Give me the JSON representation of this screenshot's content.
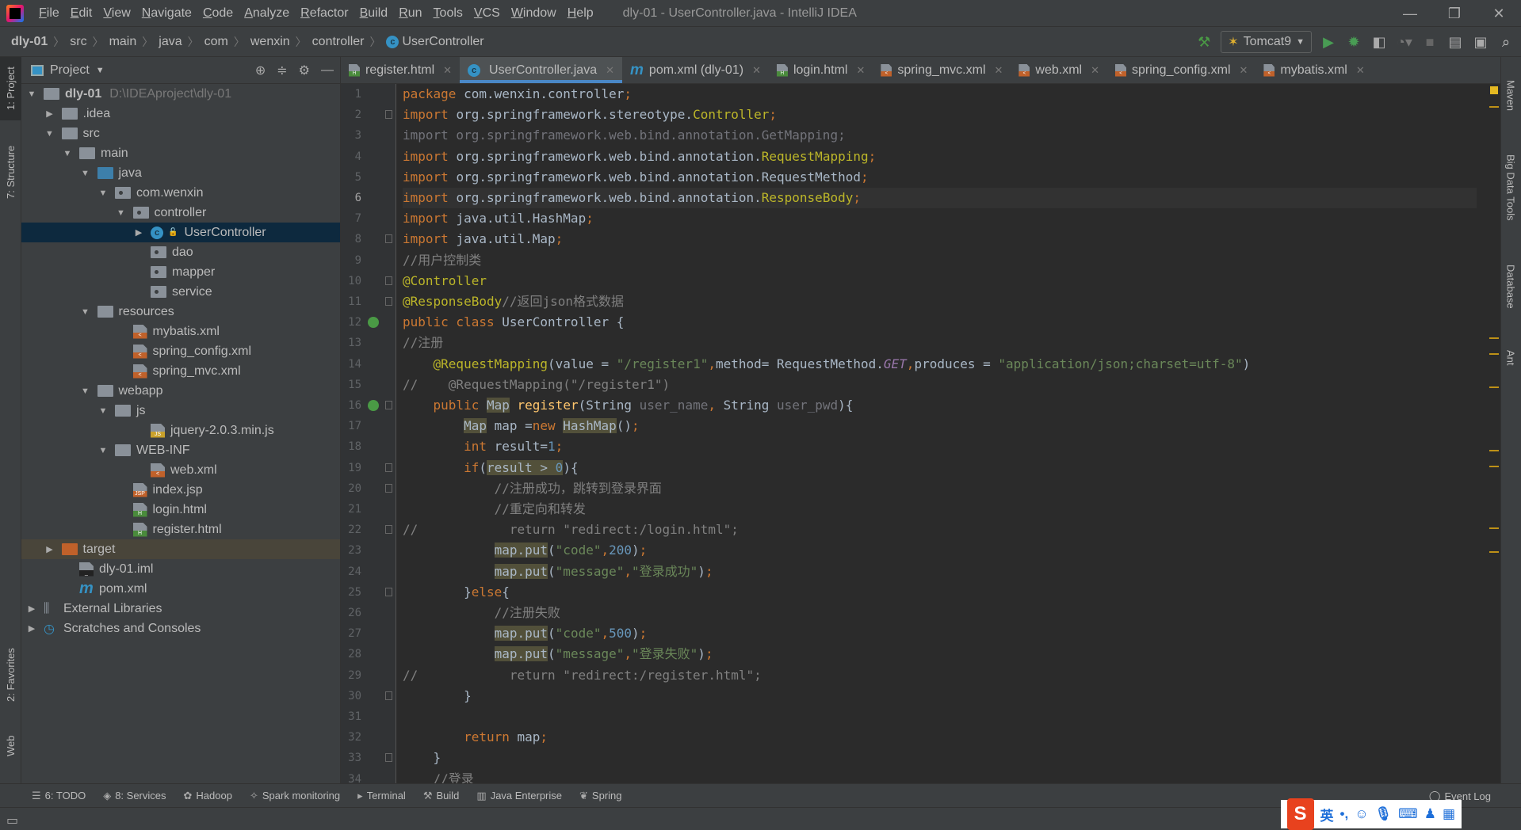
{
  "menubar": {
    "items": [
      "File",
      "Edit",
      "View",
      "Navigate",
      "Code",
      "Analyze",
      "Refactor",
      "Build",
      "Run",
      "Tools",
      "VCS",
      "Window",
      "Help"
    ],
    "title": "dly-01 - UserController.java - IntelliJ IDEA"
  },
  "breadcrumb": [
    "dly-01",
    "src",
    "main",
    "java",
    "com",
    "wenxin",
    "controller",
    "UserController"
  ],
  "toolbar": {
    "run_config": "Tomcat9",
    "icons": [
      "hammer-icon",
      "run-icon",
      "debug-icon",
      "coverage-icon",
      "profile-icon",
      "stop-icon",
      "project-structure-icon",
      "terminal-icon",
      "search-icon"
    ]
  },
  "left_stripe": [
    "1: Project",
    "7: Structure",
    "2: Favorites",
    "Web"
  ],
  "right_stripe": [
    "Maven",
    "Big Data Tools",
    "Database",
    "Ant"
  ],
  "project": {
    "title": "Project",
    "tree": [
      {
        "label": "dly-01",
        "hint": "D:\\IDEAproject\\dly-01",
        "depth": 0,
        "arrow": "down",
        "icon": "module",
        "bold": true
      },
      {
        "label": ".idea",
        "depth": 1,
        "arrow": "right",
        "icon": "folder"
      },
      {
        "label": "src",
        "depth": 1,
        "arrow": "down",
        "icon": "folder"
      },
      {
        "label": "main",
        "depth": 2,
        "arrow": "down",
        "icon": "folder"
      },
      {
        "label": "java",
        "depth": 3,
        "arrow": "down",
        "icon": "folder-blue"
      },
      {
        "label": "com.wenxin",
        "depth": 4,
        "arrow": "down",
        "icon": "package"
      },
      {
        "label": "controller",
        "depth": 5,
        "arrow": "down",
        "icon": "package"
      },
      {
        "label": "UserController",
        "depth": 6,
        "arrow": "right",
        "icon": "class",
        "selected": true
      },
      {
        "label": "dao",
        "depth": 6,
        "icon": "package"
      },
      {
        "label": "mapper",
        "depth": 6,
        "icon": "package"
      },
      {
        "label": "service",
        "depth": 6,
        "icon": "package"
      },
      {
        "label": "resources",
        "depth": 3,
        "arrow": "down",
        "icon": "folder"
      },
      {
        "label": "mybatis.xml",
        "depth": 5,
        "icon": "xml"
      },
      {
        "label": "spring_config.xml",
        "depth": 5,
        "icon": "xml"
      },
      {
        "label": "spring_mvc.xml",
        "depth": 5,
        "icon": "xml"
      },
      {
        "label": "webapp",
        "depth": 3,
        "arrow": "down",
        "icon": "folder"
      },
      {
        "label": "js",
        "depth": 4,
        "arrow": "down",
        "icon": "folder"
      },
      {
        "label": "jquery-2.0.3.min.js",
        "depth": 6,
        "icon": "js"
      },
      {
        "label": "WEB-INF",
        "depth": 4,
        "arrow": "down",
        "icon": "folder"
      },
      {
        "label": "web.xml",
        "depth": 6,
        "icon": "xml"
      },
      {
        "label": "index.jsp",
        "depth": 5,
        "icon": "jsp"
      },
      {
        "label": "login.html",
        "depth": 5,
        "icon": "html"
      },
      {
        "label": "register.html",
        "depth": 5,
        "icon": "html"
      },
      {
        "label": "target",
        "depth": 1,
        "arrow": "right",
        "icon": "folder-orange",
        "target": true
      },
      {
        "label": "dly-01.iml",
        "depth": 2,
        "icon": "iml"
      },
      {
        "label": "pom.xml",
        "depth": 2,
        "icon": "maven"
      },
      {
        "label": "External Libraries",
        "depth": 0,
        "arrow": "right",
        "icon": "libs"
      },
      {
        "label": "Scratches and Consoles",
        "depth": 0,
        "arrow": "right",
        "icon": "scratch"
      }
    ]
  },
  "tabs": [
    {
      "label": "register.html",
      "icon": "html"
    },
    {
      "label": "UserController.java",
      "icon": "class",
      "active": true
    },
    {
      "label": "pom.xml (dly-01)",
      "icon": "maven"
    },
    {
      "label": "login.html",
      "icon": "html"
    },
    {
      "label": "spring_mvc.xml",
      "icon": "xml"
    },
    {
      "label": "web.xml",
      "icon": "xml"
    },
    {
      "label": "spring_config.xml",
      "icon": "xml"
    },
    {
      "label": "mybatis.xml",
      "icon": "xml"
    }
  ],
  "editor": {
    "current_line": 6,
    "lines": [
      [
        [
          "kw",
          "package "
        ],
        [
          "pl",
          "com.wenxin.controller"
        ],
        [
          "kw",
          ";"
        ]
      ],
      [
        [
          "kw",
          "import "
        ],
        [
          "pl",
          "org.springframework.stereotype."
        ],
        [
          "an",
          "Controller"
        ],
        [
          "kw",
          ";"
        ]
      ],
      [
        [
          "gr",
          "import org.springframework.web.bind.annotation.GetMapping;"
        ]
      ],
      [
        [
          "kw",
          "import "
        ],
        [
          "pl",
          "org.springframework.web.bind.annotation."
        ],
        [
          "an",
          "RequestMapping"
        ],
        [
          "kw",
          ";"
        ]
      ],
      [
        [
          "kw",
          "import "
        ],
        [
          "pl",
          "org.springframework.web.bind.annotation.RequestMethod"
        ],
        [
          "kw",
          ";"
        ]
      ],
      [
        [
          "kw",
          "import "
        ],
        [
          "pl",
          "org.springframework.web.bind.annotation."
        ],
        [
          "an",
          "ResponseBody"
        ],
        [
          "kw",
          ";"
        ]
      ],
      [
        [
          "kw",
          "import "
        ],
        [
          "pl",
          "java.util.HashMap"
        ],
        [
          "kw",
          ";"
        ]
      ],
      [
        [
          "kw",
          "import "
        ],
        [
          "pl",
          "java.util.Map"
        ],
        [
          "kw",
          ";"
        ]
      ],
      [
        [
          "cm",
          "//用户控制类"
        ]
      ],
      [
        [
          "an",
          "@Controller"
        ]
      ],
      [
        [
          "an",
          "@ResponseBody"
        ],
        [
          "cm",
          "//返回json格式数据"
        ]
      ],
      [
        [
          "kw",
          "public class "
        ],
        [
          "pl",
          "UserController {"
        ]
      ],
      [
        [
          "cm",
          "//注册"
        ]
      ],
      [
        [
          "pl",
          "    "
        ],
        [
          "an",
          "@RequestMapping"
        ],
        [
          "pl",
          "(value = "
        ],
        [
          "str",
          "\"/register1\""
        ],
        [
          "kw",
          ","
        ],
        [
          "pl",
          "method= RequestMethod."
        ],
        [
          "it",
          "GET"
        ],
        [
          "kw",
          ","
        ],
        [
          "pl",
          "produces = "
        ],
        [
          "str",
          "\"application/json;charset=utf-8\""
        ],
        [
          "pl",
          ")"
        ]
      ],
      [
        [
          "cm",
          "//    @RequestMapping(\"/register1\")"
        ]
      ],
      [
        [
          "pl",
          "    "
        ],
        [
          "kw",
          "public "
        ],
        [
          "hl",
          "Map"
        ],
        [
          "pl",
          " "
        ],
        [
          "fn",
          "register"
        ],
        [
          "pl",
          "(String "
        ],
        [
          "gr",
          "user_name"
        ],
        [
          "kw",
          ", "
        ],
        [
          "pl",
          "String "
        ],
        [
          "gr",
          "user_pwd"
        ],
        [
          "pl",
          "){"
        ]
      ],
      [
        [
          "pl",
          "        "
        ],
        [
          "hl",
          "Map"
        ],
        [
          "pl",
          " map ="
        ],
        [
          "kw",
          "new "
        ],
        [
          "hl",
          "HashMap"
        ],
        [
          "pl",
          "()"
        ],
        [
          "kw",
          ";"
        ]
      ],
      [
        [
          "pl",
          "        "
        ],
        [
          "kw",
          "int "
        ],
        [
          "pl",
          "result="
        ],
        [
          "num",
          "1"
        ],
        [
          "kw",
          ";"
        ]
      ],
      [
        [
          "pl",
          "        "
        ],
        [
          "kw",
          "if"
        ],
        [
          "pl",
          "("
        ],
        [
          "hl",
          "result > "
        ],
        [
          "hlnum",
          "0"
        ],
        [
          "pl",
          "){"
        ]
      ],
      [
        [
          "pl",
          "            "
        ],
        [
          "cm",
          "//注册成功，跳转到登录界面"
        ]
      ],
      [
        [
          "pl",
          "            "
        ],
        [
          "cm",
          "//重定向和转发"
        ]
      ],
      [
        [
          "cm",
          "//            return \"redirect:/login.html\";"
        ]
      ],
      [
        [
          "pl",
          "            "
        ],
        [
          "hl",
          "map.put"
        ],
        [
          "pl",
          "("
        ],
        [
          "str",
          "\"code\""
        ],
        [
          "kw",
          ","
        ],
        [
          "num",
          "200"
        ],
        [
          "pl",
          ")"
        ],
        [
          "kw",
          ";"
        ]
      ],
      [
        [
          "pl",
          "            "
        ],
        [
          "hl",
          "map.put"
        ],
        [
          "pl",
          "("
        ],
        [
          "str",
          "\"message\""
        ],
        [
          "kw",
          ","
        ],
        [
          "str",
          "\"登录成功\""
        ],
        [
          "pl",
          ")"
        ],
        [
          "kw",
          ";"
        ]
      ],
      [
        [
          "pl",
          "        }"
        ],
        [
          "kw",
          "else"
        ],
        [
          "pl",
          "{"
        ]
      ],
      [
        [
          "pl",
          "            "
        ],
        [
          "cm",
          "//注册失败"
        ]
      ],
      [
        [
          "pl",
          "            "
        ],
        [
          "hl",
          "map.put"
        ],
        [
          "pl",
          "("
        ],
        [
          "str",
          "\"code\""
        ],
        [
          "kw",
          ","
        ],
        [
          "num",
          "500"
        ],
        [
          "pl",
          ")"
        ],
        [
          "kw",
          ";"
        ]
      ],
      [
        [
          "pl",
          "            "
        ],
        [
          "hl",
          "map.put"
        ],
        [
          "pl",
          "("
        ],
        [
          "str",
          "\"message\""
        ],
        [
          "kw",
          ","
        ],
        [
          "str",
          "\"登录失败\""
        ],
        [
          "pl",
          ")"
        ],
        [
          "kw",
          ";"
        ]
      ],
      [
        [
          "cm",
          "//            return \"redirect:/register.html\";"
        ]
      ],
      [
        [
          "pl",
          "        }"
        ]
      ],
      [],
      [
        [
          "pl",
          "        "
        ],
        [
          "kw",
          "return "
        ],
        [
          "pl",
          "map"
        ],
        [
          "kw",
          ";"
        ]
      ],
      [
        [
          "pl",
          "    }"
        ]
      ],
      [
        [
          "pl",
          "    "
        ],
        [
          "cm",
          "//登录"
        ]
      ]
    ]
  },
  "bottom_tools": [
    {
      "label": "6: TODO",
      "icon": "todo-icon"
    },
    {
      "label": "8: Services",
      "icon": "services-icon"
    },
    {
      "label": "Hadoop",
      "icon": "hadoop-icon"
    },
    {
      "label": "Spark monitoring",
      "icon": "spark-icon"
    },
    {
      "label": "Terminal",
      "icon": "terminal-icon"
    },
    {
      "label": "Build",
      "icon": "build-icon"
    },
    {
      "label": "Java Enterprise",
      "icon": "java-enterprise-icon"
    },
    {
      "label": "Spring",
      "icon": "spring-icon"
    }
  ],
  "event_log": "Event Log",
  "ime": {
    "mode": "英"
  }
}
